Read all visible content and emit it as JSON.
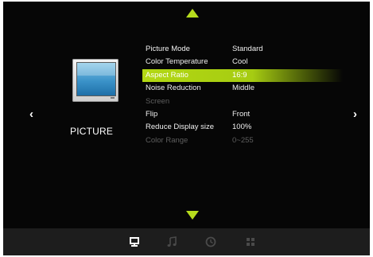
{
  "page": {
    "title": "PICTURE"
  },
  "nav": {
    "left_arrow": "‹",
    "right_arrow": "›"
  },
  "menu": {
    "items": [
      {
        "label": "Picture Mode",
        "value": "Standard",
        "state": "normal"
      },
      {
        "label": "Color Temperature",
        "value": "Cool",
        "state": "normal"
      },
      {
        "label": "Aspect Ratio",
        "value": "16:9",
        "state": "selected"
      },
      {
        "label": "Noise Reduction",
        "value": "Middle",
        "state": "normal"
      },
      {
        "label": "Screen",
        "value": "",
        "state": "disabled"
      },
      {
        "label": "Flip",
        "value": "Front",
        "state": "normal"
      },
      {
        "label": "Reduce Display size",
        "value": "100%",
        "state": "normal"
      },
      {
        "label": "Color Range",
        "value": "0~255",
        "state": "disabled"
      }
    ]
  },
  "bottom_bar": {
    "icons": [
      {
        "name": "picture-icon",
        "active": true
      },
      {
        "name": "music-icon",
        "active": false
      },
      {
        "name": "clock-icon",
        "active": false
      },
      {
        "name": "grid-icon",
        "active": false
      }
    ]
  },
  "colors": {
    "accent": "#b6dc1d",
    "background": "#060606",
    "bar": "#1d1d1d",
    "disabled_text": "#5e5e5e",
    "inactive_icon": "#4a4a4a",
    "active_icon": "#ffffff"
  }
}
